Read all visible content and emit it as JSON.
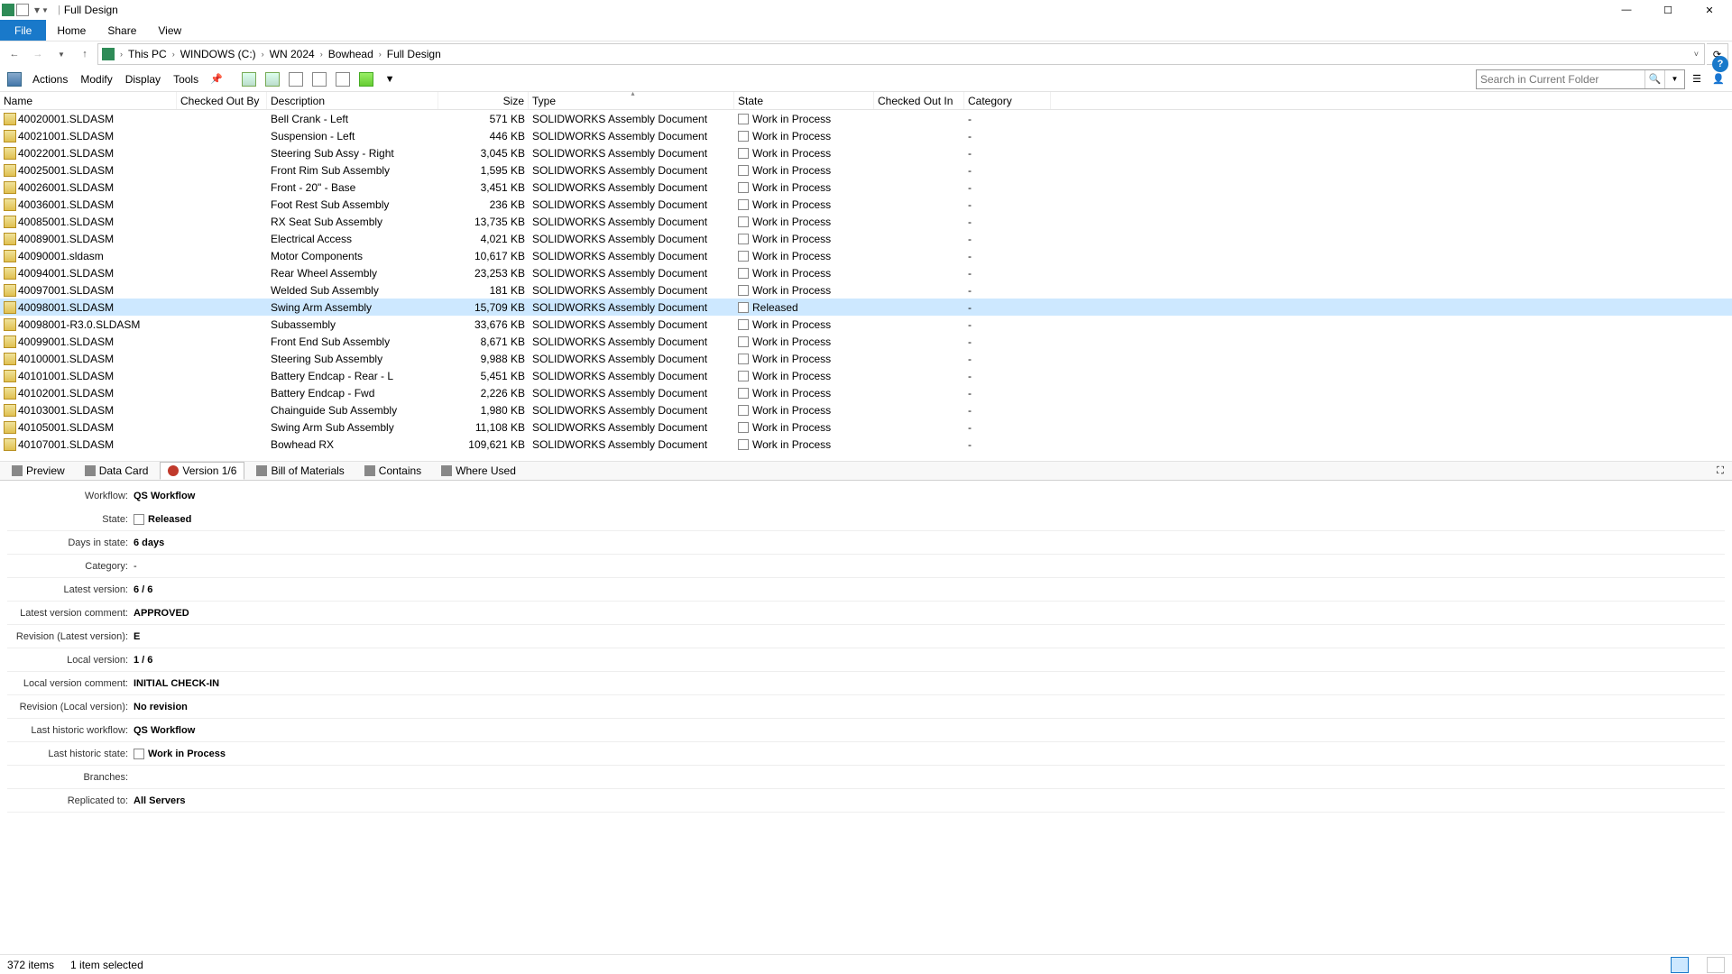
{
  "window": {
    "title": "Full Design",
    "separator": "|"
  },
  "ribbon": {
    "file": "File",
    "tabs": [
      "Home",
      "Share",
      "View"
    ]
  },
  "breadcrumb": [
    "This PC",
    "WINDOWS (C:)",
    "WN 2024",
    "Bowhead",
    "Full Design"
  ],
  "toolbar": {
    "items": [
      "Actions",
      "Modify",
      "Display",
      "Tools"
    ]
  },
  "search": {
    "placeholder": "Search in Current Folder"
  },
  "columns": {
    "name": "Name",
    "checked_out_by": "Checked Out By",
    "description": "Description",
    "size": "Size",
    "type": "Type",
    "state": "State",
    "checked_out_in": "Checked Out In",
    "category": "Category"
  },
  "rows": [
    {
      "name": "40020001.SLDASM",
      "desc": "Bell Crank - Left",
      "size": "571 KB",
      "type": "SOLIDWORKS Assembly Document",
      "state": "Work in Process",
      "cat": "-"
    },
    {
      "name": "40021001.SLDASM",
      "desc": "Suspension - Left",
      "size": "446 KB",
      "type": "SOLIDWORKS Assembly Document",
      "state": "Work in Process",
      "cat": "-"
    },
    {
      "name": "40022001.SLDASM",
      "desc": "Steering Sub Assy - Right",
      "size": "3,045 KB",
      "type": "SOLIDWORKS Assembly Document",
      "state": "Work in Process",
      "cat": "-"
    },
    {
      "name": "40025001.SLDASM",
      "desc": "Front Rim Sub Assembly",
      "size": "1,595 KB",
      "type": "SOLIDWORKS Assembly Document",
      "state": "Work in Process",
      "cat": "-"
    },
    {
      "name": "40026001.SLDASM",
      "desc": "Front - 20\" - Base",
      "size": "3,451 KB",
      "type": "SOLIDWORKS Assembly Document",
      "state": "Work in Process",
      "cat": "-"
    },
    {
      "name": "40036001.SLDASM",
      "desc": "Foot Rest Sub Assembly",
      "size": "236 KB",
      "type": "SOLIDWORKS Assembly Document",
      "state": "Work in Process",
      "cat": "-"
    },
    {
      "name": "40085001.SLDASM",
      "desc": "RX Seat Sub Assembly",
      "size": "13,735 KB",
      "type": "SOLIDWORKS Assembly Document",
      "state": "Work in Process",
      "cat": "-"
    },
    {
      "name": "40089001.SLDASM",
      "desc": "Electrical Access",
      "size": "4,021 KB",
      "type": "SOLIDWORKS Assembly Document",
      "state": "Work in Process",
      "cat": "-"
    },
    {
      "name": "40090001.sldasm",
      "desc": "Motor Components",
      "size": "10,617 KB",
      "type": "SOLIDWORKS Assembly Document",
      "state": "Work in Process",
      "cat": "-"
    },
    {
      "name": "40094001.SLDASM",
      "desc": "Rear Wheel Assembly",
      "size": "23,253 KB",
      "type": "SOLIDWORKS Assembly Document",
      "state": "Work in Process",
      "cat": "-"
    },
    {
      "name": "40097001.SLDASM",
      "desc": "Welded Sub Assembly",
      "size": "181 KB",
      "type": "SOLIDWORKS Assembly Document",
      "state": "Work in Process",
      "cat": "-"
    },
    {
      "name": "40098001.SLDASM",
      "desc": "Swing Arm Assembly",
      "size": "15,709 KB",
      "type": "SOLIDWORKS Assembly Document",
      "state": "Released",
      "cat": "-",
      "selected": true
    },
    {
      "name": "40098001-R3.0.SLDASM",
      "desc": "Subassembly",
      "size": "33,676 KB",
      "type": "SOLIDWORKS Assembly Document",
      "state": "Work in Process",
      "cat": "-"
    },
    {
      "name": "40099001.SLDASM",
      "desc": "Front End Sub Assembly",
      "size": "8,671 KB",
      "type": "SOLIDWORKS Assembly Document",
      "state": "Work in Process",
      "cat": "-"
    },
    {
      "name": "40100001.SLDASM",
      "desc": "Steering Sub Assembly",
      "size": "9,988 KB",
      "type": "SOLIDWORKS Assembly Document",
      "state": "Work in Process",
      "cat": "-"
    },
    {
      "name": "40101001.SLDASM",
      "desc": "Battery Endcap - Rear - L",
      "size": "5,451 KB",
      "type": "SOLIDWORKS Assembly Document",
      "state": "Work in Process",
      "cat": "-"
    },
    {
      "name": "40102001.SLDASM",
      "desc": "Battery Endcap - Fwd",
      "size": "2,226 KB",
      "type": "SOLIDWORKS Assembly Document",
      "state": "Work in Process",
      "cat": "-"
    },
    {
      "name": "40103001.SLDASM",
      "desc": "Chainguide Sub Assembly",
      "size": "1,980 KB",
      "type": "SOLIDWORKS Assembly Document",
      "state": "Work in Process",
      "cat": "-"
    },
    {
      "name": "40105001.SLDASM",
      "desc": "Swing Arm Sub Assembly",
      "size": "11,108 KB",
      "type": "SOLIDWORKS Assembly Document",
      "state": "Work in Process",
      "cat": "-"
    },
    {
      "name": "40107001.SLDASM",
      "desc": "Bowhead RX",
      "size": "109,621 KB",
      "type": "SOLIDWORKS Assembly Document",
      "state": "Work in Process",
      "cat": "-"
    }
  ],
  "tabs": {
    "preview": "Preview",
    "datacard": "Data Card",
    "version": "Version 1/6",
    "bom": "Bill of Materials",
    "contains": "Contains",
    "whereused": "Where Used"
  },
  "details": {
    "workflow_label": "Workflow:",
    "workflow": "QS Workflow",
    "state_label": "State:",
    "state": "Released",
    "days_label": "Days in state:",
    "days": "6 days",
    "category_label": "Category:",
    "category": "-",
    "latest_label": "Latest version:",
    "latest": "6 / 6",
    "latest_comment_label": "Latest version comment:",
    "latest_comment": "APPROVED",
    "rev_latest_label": "Revision (Latest version):",
    "rev_latest": "E",
    "local_label": "Local version:",
    "local": "1 / 6",
    "local_comment_label": "Local version comment:",
    "local_comment": "INITIAL CHECK-IN",
    "rev_local_label": "Revision (Local version):",
    "rev_local": "No revision",
    "last_workflow_label": "Last historic workflow:",
    "last_workflow": "QS Workflow",
    "last_state_label": "Last historic state:",
    "last_state": "Work in Process",
    "branches_label": "Branches:",
    "branches": "",
    "replicated_label": "Replicated to:",
    "replicated": "All Servers"
  },
  "status": {
    "items": "372 items",
    "selected": "1 item selected"
  }
}
